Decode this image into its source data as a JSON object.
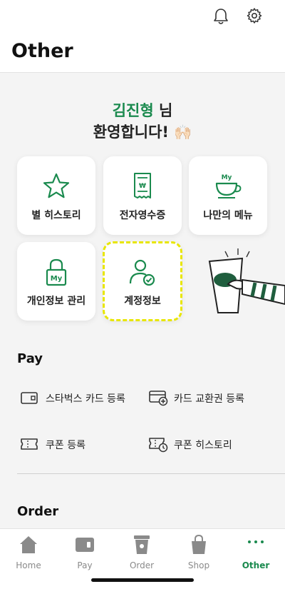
{
  "header": {
    "title": "Other"
  },
  "welcome": {
    "name": "김진형",
    "suffix": " 님",
    "line2": "환영합니다!",
    "emoji": "🙌🏻"
  },
  "tiles": [
    {
      "label": "별 히스토리",
      "icon": "star-icon"
    },
    {
      "label": "전자영수증",
      "icon": "receipt-icon"
    },
    {
      "label": "나만의 메뉴",
      "icon": "cup-icon",
      "icon_text": "My"
    },
    {
      "label": "개인정보 관리",
      "icon": "lock-icon",
      "icon_text": "My"
    },
    {
      "label": "계정정보",
      "icon": "account-icon"
    }
  ],
  "pay": {
    "title": "Pay",
    "items": [
      {
        "label": "스타벅스 카드 등록",
        "icon": "card-icon"
      },
      {
        "label": "카드 교환권 등록",
        "icon": "card-add-icon"
      },
      {
        "label": "쿠폰 등록",
        "icon": "coupon-icon"
      },
      {
        "label": "쿠폰 히스토리",
        "icon": "coupon-history-icon"
      }
    ]
  },
  "order": {
    "title": "Order"
  },
  "tabs": [
    {
      "label": "Home",
      "icon": "home-icon"
    },
    {
      "label": "Pay",
      "icon": "wallet-icon"
    },
    {
      "label": "Order",
      "icon": "coffee-cup-icon"
    },
    {
      "label": "Shop",
      "icon": "shopping-bag-icon"
    },
    {
      "label": "Other",
      "icon": "more-icon",
      "active": true
    }
  ],
  "colors": {
    "accent": "#1a8a4e",
    "highlight": "#e8e600",
    "background": "#f4f4f4"
  }
}
